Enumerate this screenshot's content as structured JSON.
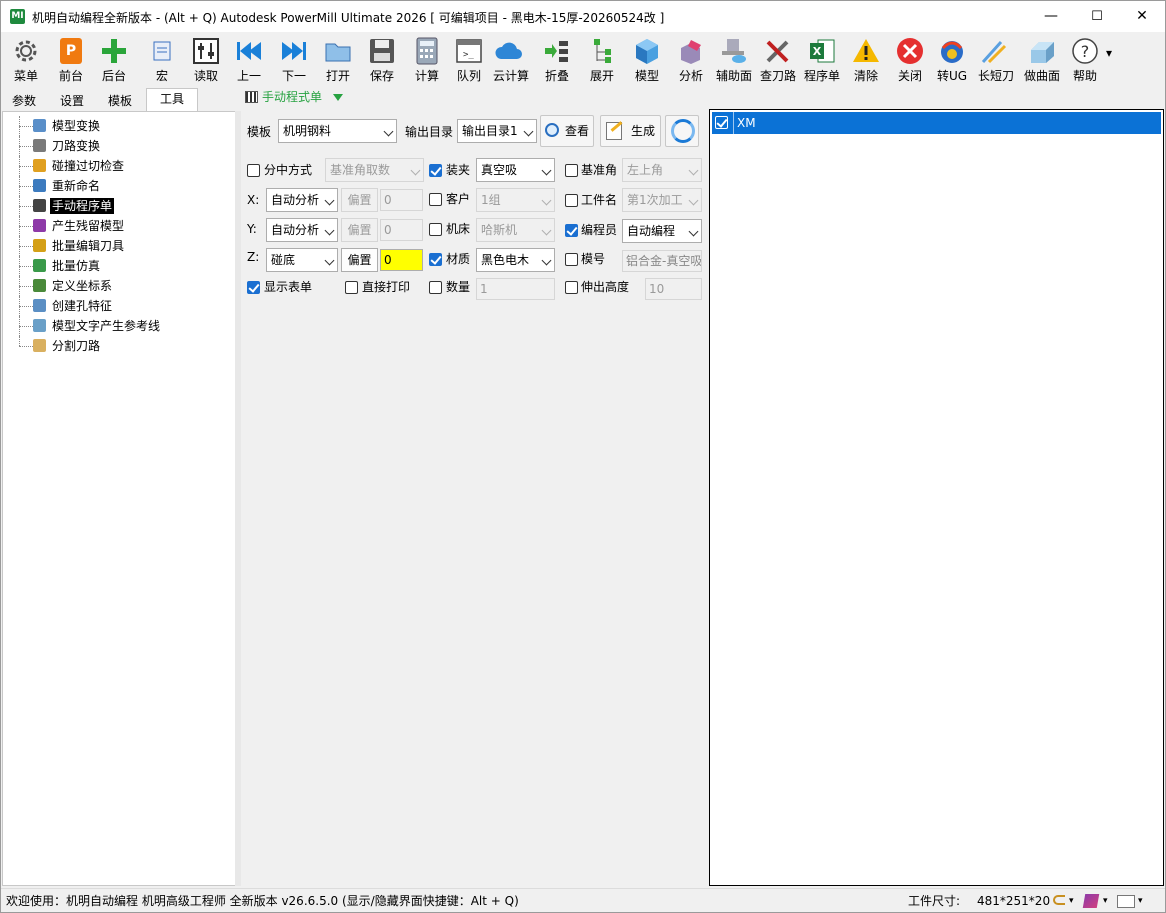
{
  "window": {
    "title": "机明自动编程全新版本 - (Alt + Q) Autodesk PowerMill Ultimate 2026    [ 可编辑项目 - 黑电木-15厚-20260524改 ]",
    "icon_text": "MI",
    "minimize": "—",
    "maximize": "☐",
    "close": "✕"
  },
  "toolbar": [
    {
      "label": "菜单",
      "icon": "gear-icon"
    },
    {
      "label": "前台",
      "icon": "powermill-icon"
    },
    {
      "label": "后台",
      "icon": "plus-icon"
    },
    {
      "label": "宏",
      "icon": "macro-icon"
    },
    {
      "label": "读取",
      "icon": "sliders-icon"
    },
    {
      "label": "上一",
      "icon": "previous-icon"
    },
    {
      "label": "下一",
      "icon": "next-icon"
    },
    {
      "label": "打开",
      "icon": "folder-open-icon"
    },
    {
      "label": "保存",
      "icon": "save-icon"
    },
    {
      "label": "计算",
      "icon": "calculator-icon"
    },
    {
      "label": "队列",
      "icon": "queue-icon"
    },
    {
      "label": "云计算",
      "icon": "cloud-icon"
    },
    {
      "label": "折叠",
      "icon": "collapse-icon"
    },
    {
      "label": "展开",
      "icon": "expand-icon"
    },
    {
      "label": "模型",
      "icon": "cube-icon"
    },
    {
      "label": "分析",
      "icon": "analysis-icon"
    },
    {
      "label": "辅助面",
      "icon": "aux-surface-icon"
    },
    {
      "label": "查刀路",
      "icon": "tools-icon"
    },
    {
      "label": "程序单",
      "icon": "excel-icon"
    },
    {
      "label": "清除",
      "icon": "warning-icon"
    },
    {
      "label": "关闭",
      "icon": "close-circle-icon"
    },
    {
      "label": "转UG",
      "icon": "ug-icon"
    },
    {
      "label": "长短刀",
      "icon": "tool-length-icon"
    },
    {
      "label": "做曲面",
      "icon": "surface-icon"
    },
    {
      "label": "帮助",
      "icon": "help-icon"
    }
  ],
  "toolbar_more": "▾",
  "left_tabs": [
    "参数",
    "设置",
    "模板",
    "工具"
  ],
  "active_tab": "工具",
  "tree_items": [
    {
      "label": "模型变换",
      "color": "#5a8fc9"
    },
    {
      "label": "刀路变换",
      "color": "#7a7a7a"
    },
    {
      "label": "碰撞过切检查",
      "color": "#e0a020"
    },
    {
      "label": "重新命名",
      "color": "#3c7bbf"
    },
    {
      "label": "手动程序单",
      "color": "#444444"
    },
    {
      "label": "产生残留模型",
      "color": "#8e3aa8"
    },
    {
      "label": "批量编辑刀具",
      "color": "#d4a017"
    },
    {
      "label": "批量仿真",
      "color": "#3a9a4a"
    },
    {
      "label": "定义坐标系",
      "color": "#4a8a3a"
    },
    {
      "label": "创建孔特征",
      "color": "#5b8fc4"
    },
    {
      "label": "模型文字产生参考线",
      "color": "#6aa0c8"
    },
    {
      "label": "分割刀路",
      "color": "#d9b060"
    }
  ],
  "selected_tree_item": 4,
  "panel": {
    "header": "手动程式单",
    "template_label": "模板",
    "template_value": "机明钢料",
    "output_dir_label": "输出目录",
    "output_dir_value": "输出目录1",
    "view_button": "查看",
    "generate_button": "生成",
    "split_mode_label": "分中方式",
    "split_mode_value": "基准角取数",
    "clamp_label": "装夹",
    "clamp_value": "真空吸",
    "datum_corner_label": "基准角",
    "datum_corner_value": "左上角",
    "x_label": "X:",
    "x_mode": "自动分析",
    "x_offset_button": "偏置",
    "x_offset_value": "0",
    "customer_label": "客户",
    "customer_value": "1组",
    "workpiece_name_label": "工件名",
    "workpiece_name_value": "第1次加工",
    "y_label": "Y:",
    "y_mode": "自动分析",
    "y_offset_button": "偏置",
    "y_offset_value": "0",
    "machine_label": "机床",
    "machine_value": "哈斯机",
    "programmer_label": "编程员",
    "programmer_value": "自动编程",
    "z_label": "Z:",
    "z_mode": "碰底",
    "z_offset_button": "偏置",
    "z_offset_value": "0",
    "material_label": "材质",
    "material_value": "黑色电木",
    "mold_no_label": "模号",
    "mold_no_value": "铝合金-真空吸",
    "show_sheet_label": "显示表单",
    "direct_print_label": "直接打印",
    "quantity_label": "数量",
    "quantity_value": "1",
    "extension_label": "伸出高度",
    "extension_value": "10"
  },
  "checks": {
    "split_mode": false,
    "clamp": true,
    "datum_corner": false,
    "customer": false,
    "workpiece_name": false,
    "machine": false,
    "programmer": true,
    "material": true,
    "mold_no": false,
    "show_sheet": true,
    "direct_print": false,
    "quantity": false,
    "extension": false
  },
  "program_list": [
    {
      "label": "XM",
      "checked": true,
      "selected": true
    }
  ],
  "status": {
    "welcome": "欢迎使用：机明自动编程 机明高级工程师 全新版本 v26.6.5.0  (显示/隐藏界面快捷键：Alt + Q)",
    "size_label": "工件尺寸:",
    "size_value": "481*251*20"
  },
  "colors": {
    "accent": "#0b72d6",
    "highlight_input": "#ffff00",
    "panel_header": "#27a241"
  }
}
